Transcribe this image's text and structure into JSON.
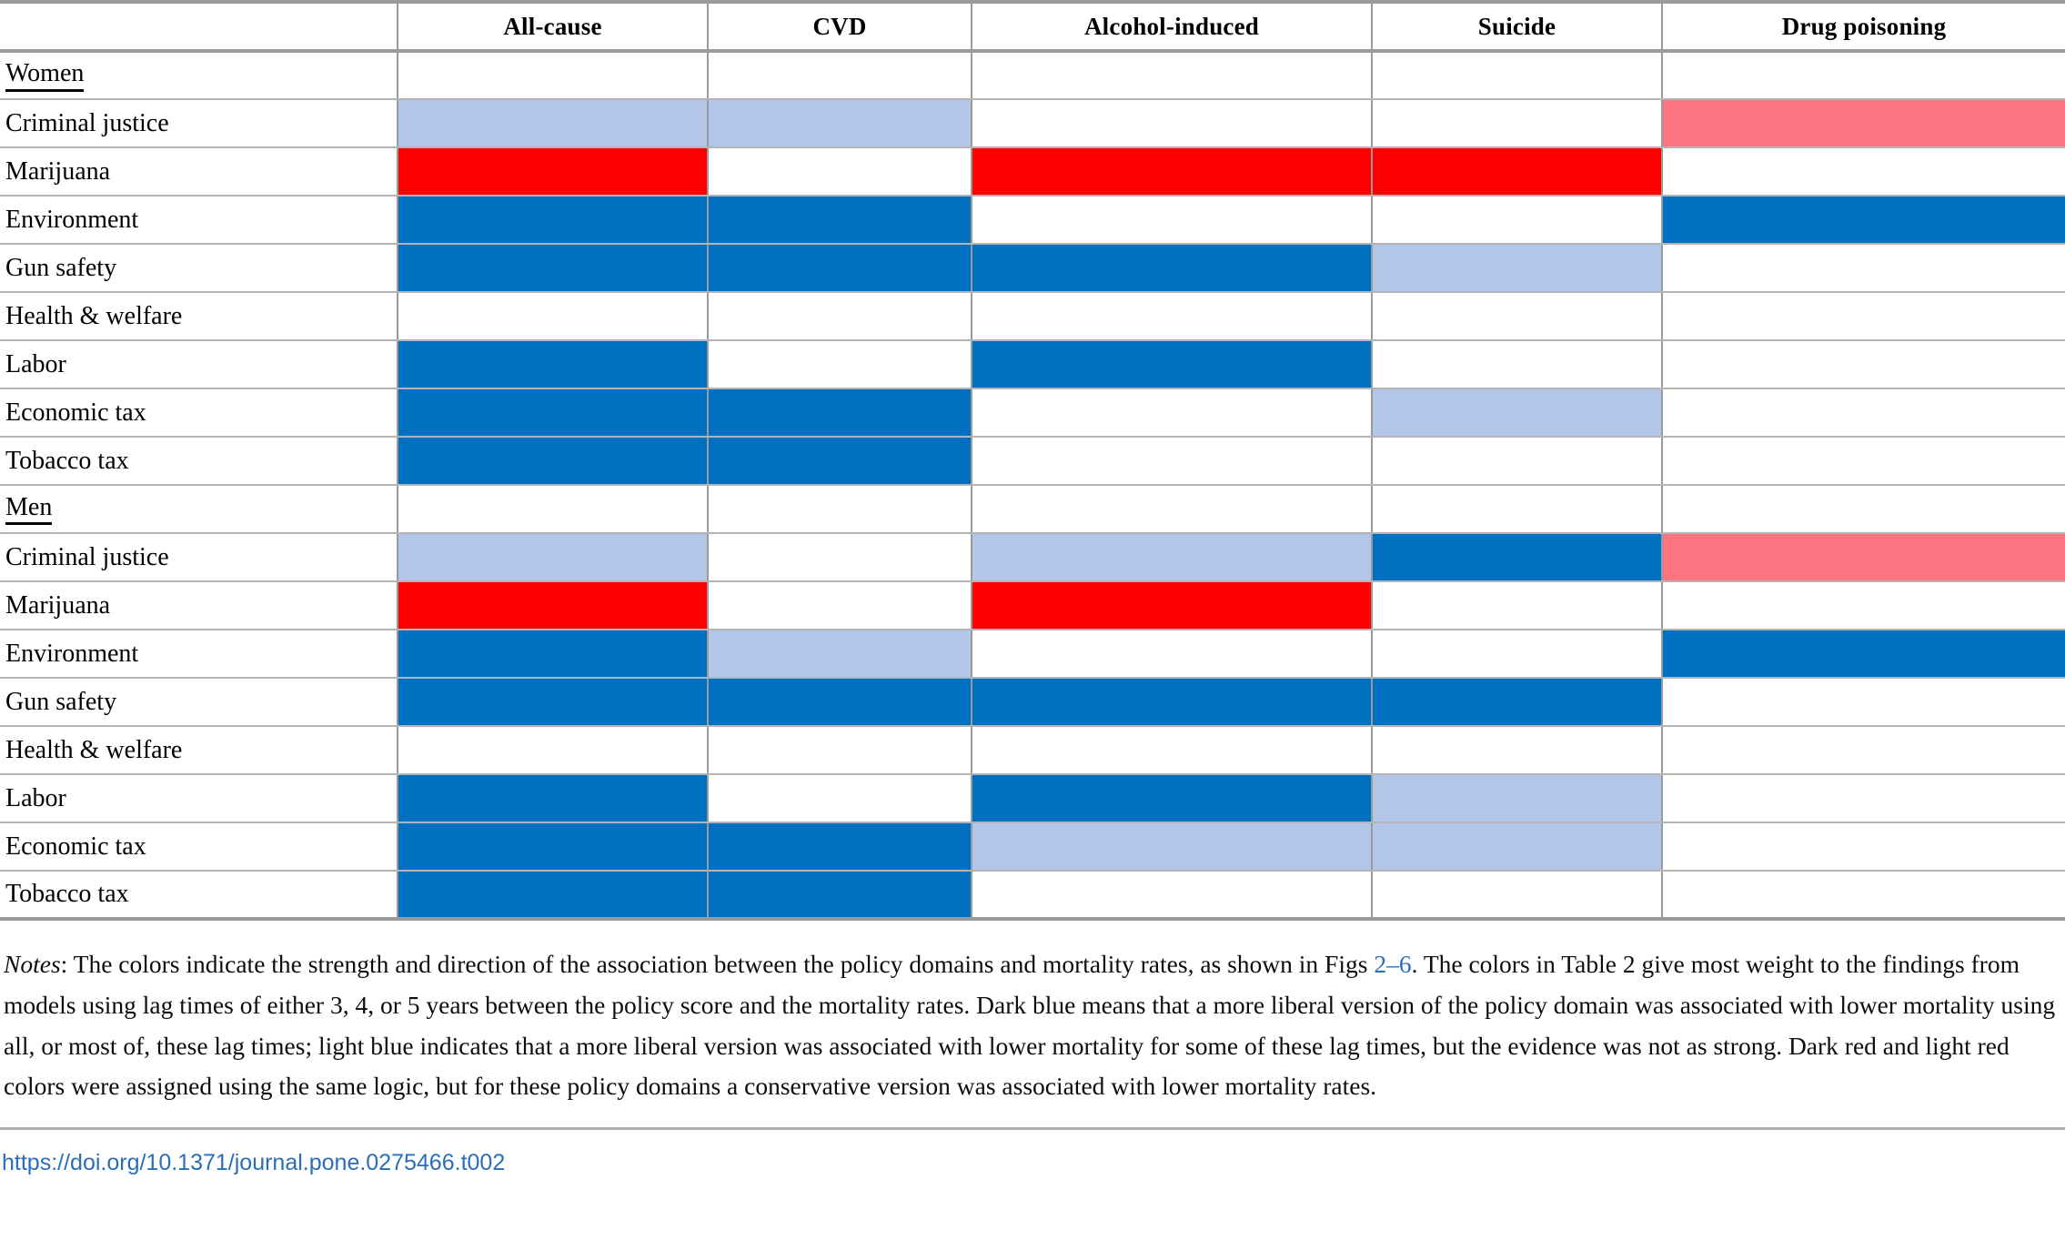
{
  "table": {
    "columns": [
      {
        "key": "label",
        "label": ""
      },
      {
        "key": "all_cause",
        "label": "All-cause"
      },
      {
        "key": "cvd",
        "label": "CVD"
      },
      {
        "key": "alcohol",
        "label": "Alcohol-induced"
      },
      {
        "key": "suicide",
        "label": "Suicide"
      },
      {
        "key": "drug",
        "label": "Drug poisoning"
      }
    ],
    "rows": [
      {
        "label": "Women",
        "type": "section",
        "cells": [
          "none",
          "none",
          "none",
          "none",
          "none"
        ]
      },
      {
        "label": "Criminal justice",
        "type": "data",
        "cells": [
          "lightblue",
          "lightblue",
          "none",
          "none",
          "lightred"
        ]
      },
      {
        "label": "Marijuana",
        "type": "data",
        "cells": [
          "red",
          "none",
          "red",
          "red",
          "none"
        ]
      },
      {
        "label": "Environment",
        "type": "data",
        "cells": [
          "blue",
          "blue",
          "none",
          "none",
          "blue"
        ]
      },
      {
        "label": "Gun safety",
        "type": "data",
        "cells": [
          "blue",
          "blue",
          "blue",
          "lightblue",
          "none"
        ]
      },
      {
        "label": "Health & welfare",
        "type": "data",
        "cells": [
          "none",
          "none",
          "none",
          "none",
          "none"
        ]
      },
      {
        "label": "Labor",
        "type": "data",
        "cells": [
          "blue",
          "none",
          "blue",
          "none",
          "none"
        ]
      },
      {
        "label": "Economic tax",
        "type": "data",
        "cells": [
          "blue",
          "blue",
          "none",
          "lightblue",
          "none"
        ]
      },
      {
        "label": "Tobacco tax",
        "type": "data",
        "cells": [
          "blue",
          "blue",
          "none",
          "none",
          "none"
        ]
      },
      {
        "label": "Men",
        "type": "section",
        "cells": [
          "none",
          "none",
          "none",
          "none",
          "none"
        ]
      },
      {
        "label": "Criminal justice",
        "type": "data",
        "cells": [
          "lightblue",
          "none",
          "lightblue",
          "blue",
          "lightred"
        ]
      },
      {
        "label": "Marijuana",
        "type": "data",
        "cells": [
          "red",
          "none",
          "red",
          "none",
          "none"
        ]
      },
      {
        "label": "Environment",
        "type": "data",
        "cells": [
          "blue",
          "lightblue",
          "none",
          "none",
          "blue"
        ]
      },
      {
        "label": "Gun safety",
        "type": "data",
        "cells": [
          "blue",
          "blue",
          "blue",
          "blue",
          "none"
        ]
      },
      {
        "label": "Health & welfare",
        "type": "data",
        "cells": [
          "none",
          "none",
          "none",
          "none",
          "none"
        ]
      },
      {
        "label": "Labor",
        "type": "data",
        "cells": [
          "blue",
          "none",
          "blue",
          "lightblue",
          "none"
        ]
      },
      {
        "label": "Economic tax",
        "type": "data",
        "cells": [
          "blue",
          "blue",
          "lightblue",
          "lightblue",
          "none"
        ]
      },
      {
        "label": "Tobacco tax",
        "type": "data",
        "cells": [
          "blue",
          "blue",
          "none",
          "none",
          "none"
        ]
      }
    ],
    "legend_colors": {
      "blue": "#0070C0",
      "lightblue": "#B3C6E7",
      "red": "#FF0000",
      "lightred": "#FB7681",
      "none": "#FFFFFF"
    }
  },
  "notes": {
    "lead": "Notes",
    "part1": ": The colors indicate the strength and direction of the association between the policy domains and mortality rates, as shown in Figs ",
    "figs_link": "2–6",
    "part2": ". The colors in Table 2 give most weight to the findings from models using lag times of either 3, 4, or 5 years between the policy score and the mortality rates. Dark blue means that a more liberal version of the policy domain was associated with lower mortality using all, or most of, these lag times; light blue indicates that a more liberal version was associated with lower mortality for some of these lag times, but the evidence was not as strong. Dark red and light red colors were assigned using the same logic, but for these policy domains a conservative version was associated with lower mortality rates."
  },
  "doi": {
    "text": "https://doi.org/10.1371/journal.pone.0275466.t002"
  }
}
